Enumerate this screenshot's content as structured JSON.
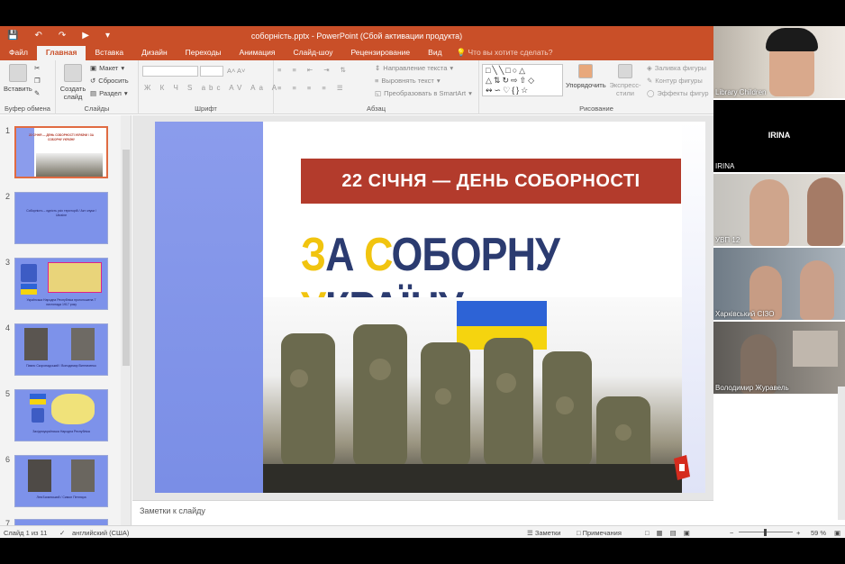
{
  "window": {
    "title": "соборність.pptx - PowerPoint (Сбой активации продукта)"
  },
  "tabs": [
    {
      "label": "Файл"
    },
    {
      "label": "Главная",
      "active": true
    },
    {
      "label": "Вставка"
    },
    {
      "label": "Дизайн"
    },
    {
      "label": "Переходы"
    },
    {
      "label": "Анимация"
    },
    {
      "label": "Слайд-шоу"
    },
    {
      "label": "Рецензирование"
    },
    {
      "label": "Вид"
    }
  ],
  "tell_me": "Что вы хотите сделать?",
  "ribbon": {
    "paste": "Вставить",
    "clipboard_group": "Буфер обмена",
    "create_slide": "Создать слайд",
    "layout": "Макет",
    "reset": "Сбросить",
    "section": "Раздел",
    "slides_group": "Слайды",
    "font_group": "Шрифт",
    "text_direction": "Направление текста",
    "align_text": "Выровнять текст",
    "smartart": "Преобразовать в SmartArt",
    "paragraph_group": "Абзац",
    "arrange": "Упорядочить",
    "quick_styles": "Экспресс-стили",
    "shape_fill": "Заливка фигуры",
    "shape_outline": "Контур фигуры",
    "shape_effects": "Эффекты фигур",
    "drawing_group": "Рисование"
  },
  "thumbnails": [
    {
      "num": "1",
      "text": "22 СІЧНЯ — ДЕНЬ СОБОРНОСТІ УКРАЇНИ / ЗА СОБОРНУ УКРАЇНУ",
      "selected": true
    },
    {
      "num": "2",
      "text": "Соборність – єдність усіх територій / Акт злуки / Ukraine"
    },
    {
      "num": "3",
      "text": "Українська Народна Республіка проголошена 7 листопада 1917 року"
    },
    {
      "num": "4",
      "text": "Павло Скоропадський / Володимир Винниченко"
    },
    {
      "num": "5",
      "text": "Західноукраїнська Народна Республіка"
    },
    {
      "num": "6",
      "text": "Лев Бачинський / Симон Петлюра"
    },
    {
      "num": "7",
      "text": ""
    }
  ],
  "slide": {
    "banner": "22 СІЧНЯ — ДЕНЬ СОБОРНОСТІ УКРАЇНИ",
    "title_parts": [
      "З",
      "А ",
      "С",
      "ОБОРНУ ",
      "У",
      "КРАЇНУ"
    ]
  },
  "notes_placeholder": "Заметки к слайду",
  "status": {
    "slide_count": "Слайд 1 из 11",
    "language": "английский (США)",
    "notes": "Заметки",
    "comments": "Примечания",
    "zoom": "59 %"
  },
  "video_tiles": [
    {
      "name": "Library Children"
    },
    {
      "name": "IRINA",
      "center": "IRINA"
    },
    {
      "name": "УВП 12"
    },
    {
      "name": "Харківський СІЗО"
    },
    {
      "name": "Володимир Журавель"
    }
  ],
  "colors": {
    "accent": "#c94f28",
    "banner": "#b33b2c",
    "title_blue": "#2b3b70",
    "title_yellow": "#f1c40f",
    "slide_blue": "#7d92ea"
  }
}
